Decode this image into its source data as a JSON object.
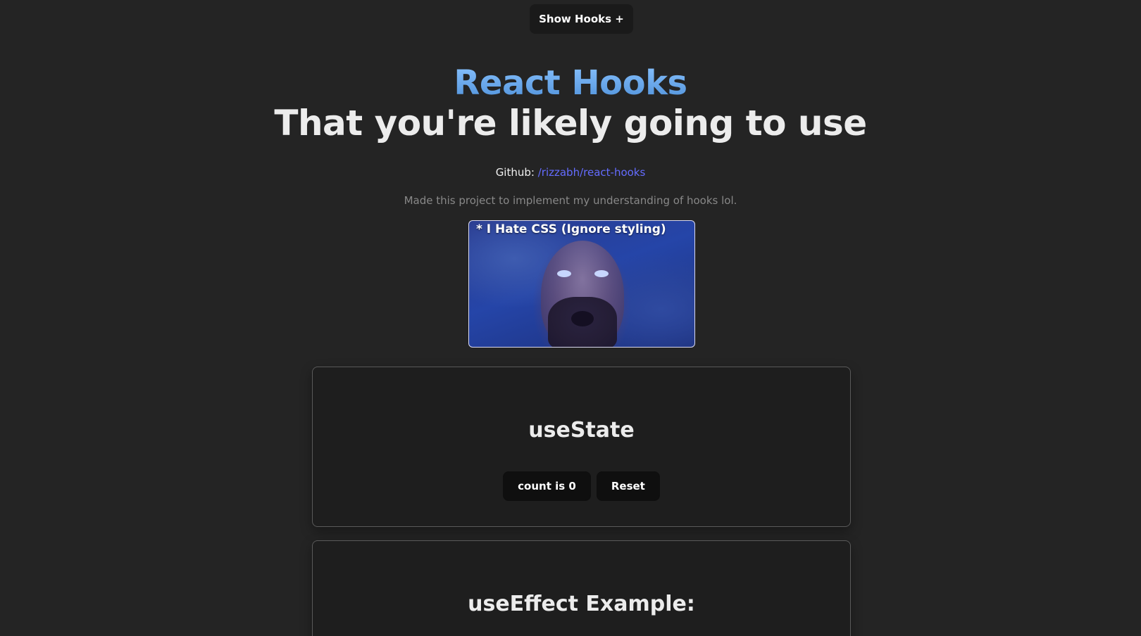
{
  "header": {
    "show_hooks_label": "Show Hooks +"
  },
  "hero": {
    "title": "React Hooks",
    "subtitle": "That you're likely going to use"
  },
  "github": {
    "prefix": "Github:",
    "link_text": "/rizzabh/react-hooks"
  },
  "description": "Made this project to implement my understanding of hooks lol.",
  "meme": {
    "caption": "* I Hate CSS (Ignore styling)"
  },
  "cards": {
    "use_state": {
      "title": "useState",
      "count_label": "count is 0",
      "reset_label": "Reset"
    },
    "use_effect": {
      "title": "useEffect Example:"
    }
  },
  "colors": {
    "background": "#242424",
    "title_gradient_top": "#8bc4ff",
    "title_gradient_bottom": "#4c8ed8",
    "link": "#646cff",
    "button_bg": "#0f0f0f"
  }
}
